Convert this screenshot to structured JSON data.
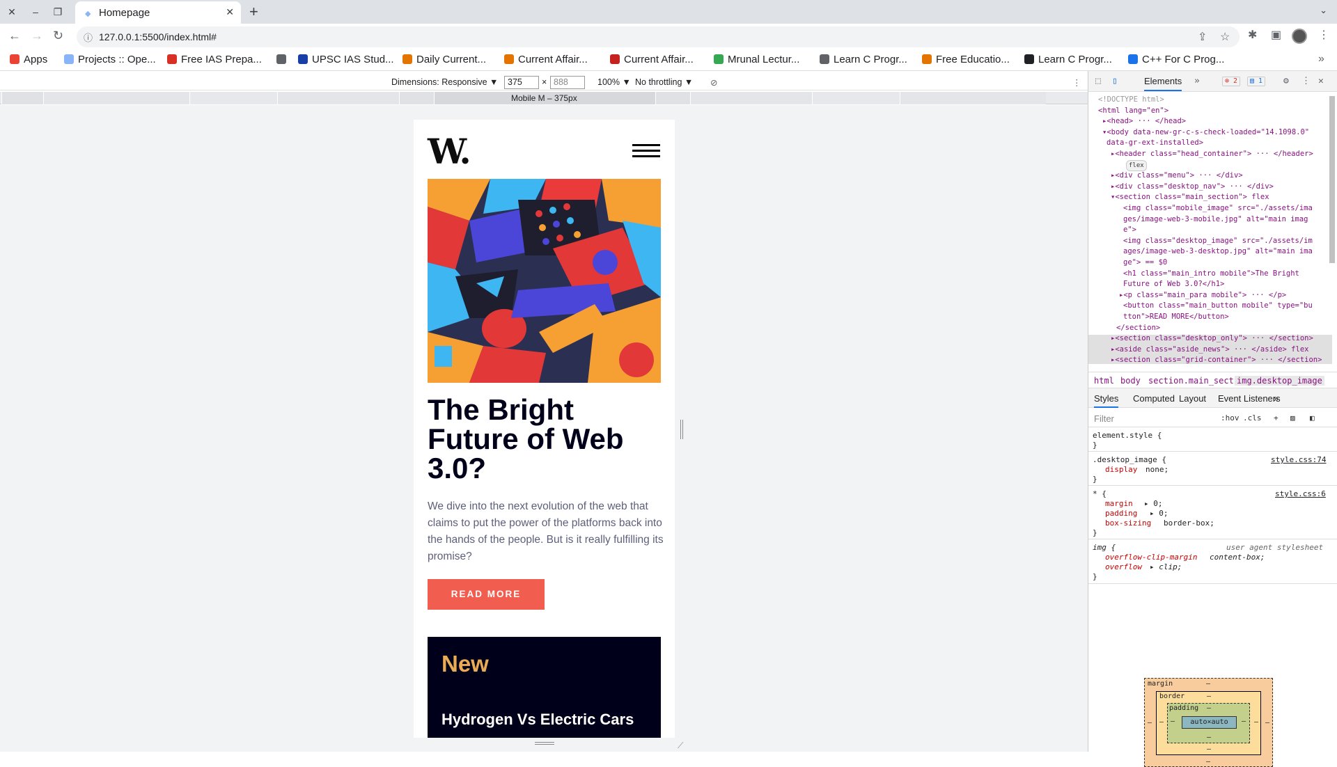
{
  "browser": {
    "tab_title": "Homepage",
    "url": "127.0.0.1:5500/index.html#",
    "bookmarks": [
      {
        "label": "Apps",
        "icon": "apps-grid-icon",
        "color": "#ea4335"
      },
      {
        "label": "Projects :: Ope...",
        "icon": "projects-icon",
        "color": "#8ab4f8"
      },
      {
        "label": "Free IAS Prepa...",
        "icon": "ias-icon",
        "color": "#d93025"
      },
      {
        "label": "",
        "icon": "globe-icon",
        "color": "#5f6368"
      },
      {
        "label": "UPSC IAS Stud...",
        "icon": "upsc-icon",
        "color": "#1a3ea8"
      },
      {
        "label": "Daily Current...",
        "icon": "person-icon",
        "color": "#e37400"
      },
      {
        "label": "Current Affair...",
        "icon": "current-affairs-icon",
        "color": "#e37400"
      },
      {
        "label": "Current Affair...",
        "icon": "shield-icon",
        "color": "#c5221f"
      },
      {
        "label": "Mrunal Lectur...",
        "icon": "drive-icon",
        "color": "#34a853"
      },
      {
        "label": "Learn C Progr...",
        "icon": "globe-icon",
        "color": "#5f6368"
      },
      {
        "label": "Free Educatio...",
        "icon": "education-icon",
        "color": "#e37400"
      },
      {
        "label": "Learn C Progr...",
        "icon": "c-prog-icon",
        "color": "#202124"
      },
      {
        "label": "C++ For C Prog...",
        "icon": "cpp-icon",
        "color": "#1a73e8"
      }
    ]
  },
  "device_toolbar": {
    "dimensions_label": "Dimensions: Responsive ▼",
    "width": "375",
    "height": "888",
    "zoom": "100% ▼",
    "throttling": "No throttling ▼",
    "ruler_label": "Mobile M – 375px"
  },
  "page": {
    "logo": "W.",
    "headline": "The Bright Future of Web 3.0?",
    "paragraph": "We dive into the next evolution of the web that claims to put the power of the platforms back into the hands of the people. But is it really fulfilling its promise?",
    "button": "READ MORE",
    "new_title": "New",
    "new_item": "Hydrogen Vs Electric Cars",
    "accent_color": "#f15e50",
    "dark_color": "#00001a",
    "orange_color": "#e9ab53"
  },
  "devtools": {
    "tab_elements": "Elements",
    "errors": "2",
    "messages": "1",
    "dom_lines": [
      "<!DOCTYPE html>",
      "<html lang=\"en\">",
      "▸<head> ··· </head>",
      "▾<body data-new-gr-c-s-check-loaded=\"14.1098.0\"",
      "data-gr-ext-installed>",
      "▸<header class=\"head_container\"> ··· </header>",
      "flex",
      "▸<div class=\"menu\"> ··· </div>",
      "▸<div class=\"desktop_nav\"> ··· </div>",
      "▾<section class=\"main_section\"> flex",
      "<img class=\"mobile_image\" src=\"./assets/ima",
      "ges/image-web-3-mobile.jpg\" alt=\"main imag",
      "e\">",
      "<img class=\"desktop_image\" src=\"./assets/im",
      "ages/image-web-3-desktop.jpg\" alt=\"main ima",
      "ge\"> == $0",
      "<h1 class=\"main_intro mobile\">The Bright",
      "Future of Web 3.0?</h1>",
      "▸<p class=\"main_para mobile\"> ··· </p>",
      "<button class=\"main_button mobile\" type=\"bu",
      "tton\">READ MORE</button>",
      "</section>",
      "▸<section class=\"desktop_only\"> ··· </section>",
      "▸<aside class=\"aside_news\"> ··· </aside> flex",
      "▸<section class=\"grid-container\"> ··· </section>"
    ],
    "breadcrumbs": [
      "html",
      "body",
      "section.main_section",
      "img.desktop_image"
    ],
    "style_tabs": [
      "Styles",
      "Computed",
      "Layout",
      "Event Listeners",
      "»"
    ],
    "filter_placeholder": "Filter",
    "hov": ":hov",
    "cls": ".cls",
    "rules": {
      "element_style": "element.style {",
      "close": "}",
      "r1_selector": ".desktop_image {",
      "r1_source": "style.css:74",
      "r1_prop": "display",
      "r1_val": "none;",
      "r2_selector": "* {",
      "r2_source": "style.css:6",
      "r2_p1": "margin",
      "r2_v1": "▸ 0;",
      "r2_p2": "padding",
      "r2_v2": "▸ 0;",
      "r2_p3": "box-sizing",
      "r2_v3": "border-box;",
      "r3_selector": "img {",
      "r3_source": "user agent stylesheet",
      "r3_p1": "overflow-clip-margin",
      "r3_v1": "content-box;",
      "r3_p2": "overflow",
      "r3_v2": "▸ clip;"
    },
    "box_model": {
      "margin": "margin",
      "border": "border",
      "padding": "padding",
      "content": "auto×auto",
      "dash": "–"
    }
  }
}
